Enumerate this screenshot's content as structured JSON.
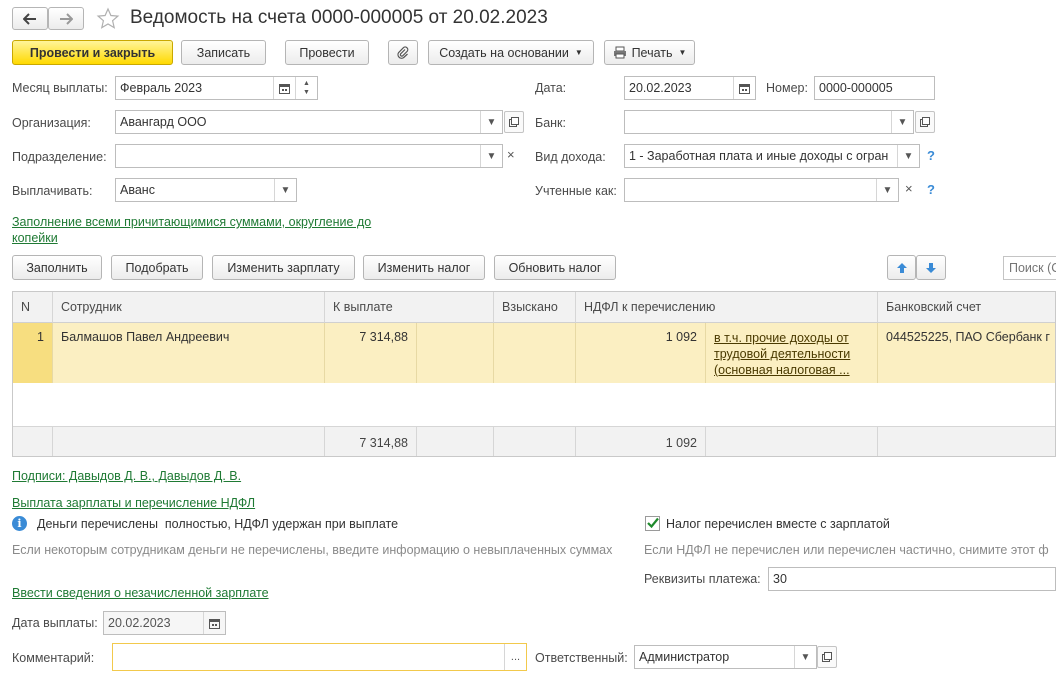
{
  "window": {
    "title": "Ведомость на счета 0000-000005 от 20.02.2023",
    "nav_back_icon": "arrow-left-icon",
    "nav_forward_icon": "arrow-right-icon",
    "favorite_icon": "star-icon"
  },
  "toolbar": {
    "post_close": "Провести и закрыть",
    "save": "Записать",
    "post": "Провести",
    "attach_icon": "paperclip-icon",
    "create_based": "Создать на основании",
    "print": "Печать"
  },
  "form": {
    "month_label": "Месяц выплаты:",
    "month_value": "Февраль 2023",
    "date_label": "Дата:",
    "date_value": "20.02.2023",
    "number_label": "Номер:",
    "number_value": "0000-000005",
    "org_label": "Организация:",
    "org_value": "Авангард ООО",
    "bank_label": "Банк:",
    "bank_value": "",
    "dept_label": "Подразделение:",
    "dept_value": "",
    "income_label": "Вид дохода:",
    "income_value": "1 - Заработная плата и иные доходы с огран",
    "pay_label": "Выплачивать:",
    "pay_value": "Аванс",
    "counted_label": "Учтенные как:",
    "counted_value": "",
    "help_mark": "?",
    "fill_link_line1": "Заполнение всеми причитающимися суммами, округление до",
    "fill_link_line2": "копейки"
  },
  "table_toolbar": {
    "fill": "Заполнить",
    "select": "Подобрать",
    "change_salary": "Изменить зарплату",
    "change_tax": "Изменить налог",
    "refresh_tax": "Обновить налог",
    "search_placeholder": "Поиск (C"
  },
  "table": {
    "headers": {
      "n": "N",
      "employee": "Сотрудник",
      "to_pay": "К выплате",
      "collected": "Взыскано",
      "ndfl": "НДФЛ к перечислению",
      "account": "Банковский счет"
    },
    "rows": [
      {
        "n": "1",
        "employee": "Балмашов Павел Андреевич",
        "to_pay": "7 314,88",
        "collected": "",
        "ndfl": "1 092",
        "ndfl_note_1": "в т.ч. прочие доходы от",
        "ndfl_note_2": "трудовой деятельности",
        "ndfl_note_3": "(основная налоговая ...",
        "account": "044525225, ПАО Сбербанк г"
      }
    ],
    "totals": {
      "to_pay": "7 314,88",
      "ndfl": "1 092"
    }
  },
  "bottom": {
    "signatures_link": "Подписи: Давыдов Д. В., Давыдов Д. В.",
    "payment_link": "Выплата зарплаты и перечисление НДФЛ",
    "info_icon": "info-icon",
    "money_status": "Деньги перечислены  полностью, НДФЛ удержан при выплате",
    "money_hint": "Если некоторым сотрудникам деньги не перечислены, введите информацию о невыплаченных суммах",
    "tax_checkbox_label": "Налог перечислен вместе с зарплатой",
    "tax_checked": true,
    "tax_hint": "Если НДФЛ не перечислен или перечислен частично, снимите этот ф",
    "payment_details_label": "Реквизиты платежа:",
    "payment_details_value": "30",
    "unaccrued_link": "Ввести сведения о незачисленной зарплате",
    "pay_date_label": "Дата выплаты:",
    "pay_date_value": "20.02.2023",
    "comment_label": "Комментарий:",
    "comment_value": "",
    "responsible_label": "Ответственный:",
    "responsible_value": "Администратор"
  },
  "colors": {
    "primary_button": "#ffd900",
    "selected_row": "#fbefc2",
    "link_green": "#1f7a34",
    "help_blue": "#3a8bd6"
  }
}
